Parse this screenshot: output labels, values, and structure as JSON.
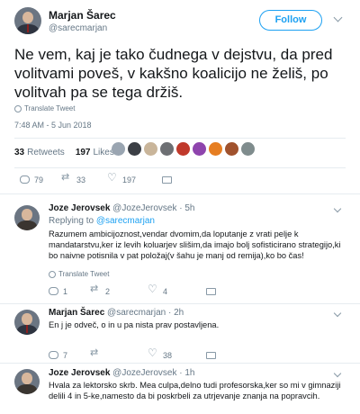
{
  "main_tweet": {
    "name": "Marjan Šarec",
    "handle": "@sarecmarjan",
    "follow_label": "Follow",
    "text": "Ne vem, kaj je tako čudnega v dejstvu, da pred volitvami poveš, v kakšno koalicijo ne želiš, po volitvah pa se tega držiš.",
    "translate_label": "Translate Tweet",
    "timestamp": "7:48 AM - 5 Jun 2018",
    "retweets_count": "33",
    "retweets_label": "Retweets",
    "likes_count": "197",
    "likes_label": "Likes",
    "likers_colors": [
      "#9aa5b1",
      "#3b3f45",
      "#c9b59a",
      "#6d6f73",
      "#c0392b",
      "#8e44ad",
      "#e67e22",
      "#a0522d",
      "#7f8c8d"
    ],
    "actions": {
      "reply_count": "79",
      "retweet_count": "33",
      "like_count": "197"
    }
  },
  "replies": [
    {
      "name": "Joze Jerovsek",
      "handle": "@JozeJerovsek · 5h",
      "replying_prefix": "Replying to",
      "replying_to": "@sarecmarjan",
      "text": "Razumem ambicijoznost,vendar dvomim,da loputanje z vrati pelje k mandatarstvu,ker iz levih koluarjev slišim,da imajo bolj sofisticirano strategijo,ki bo naivne potisnila v pat položaj(v šahu je manj od remija),ko bo čas!",
      "translate_label": "Translate Tweet",
      "reply_count": "1",
      "retweet_count": "2",
      "like_count": "4"
    },
    {
      "name": "Marjan Šarec",
      "handle": "@sarecmarjan · 2h",
      "text": "En j je odveč, o in u pa nista prav postavljena.",
      "reply_count": "7",
      "retweet_count": "",
      "like_count": "38"
    },
    {
      "name": "Joze Jerovsek",
      "handle": "@JozeJerovsek · 1h",
      "text": "Hvala za lektorsko skrb. Mea culpa,delno tudi profesorska,ker so mi v gimnaziji delili 4 in 5-ke,namesto da bi poskrbeli za utrjevanje znanja na popravcih."
    }
  ]
}
